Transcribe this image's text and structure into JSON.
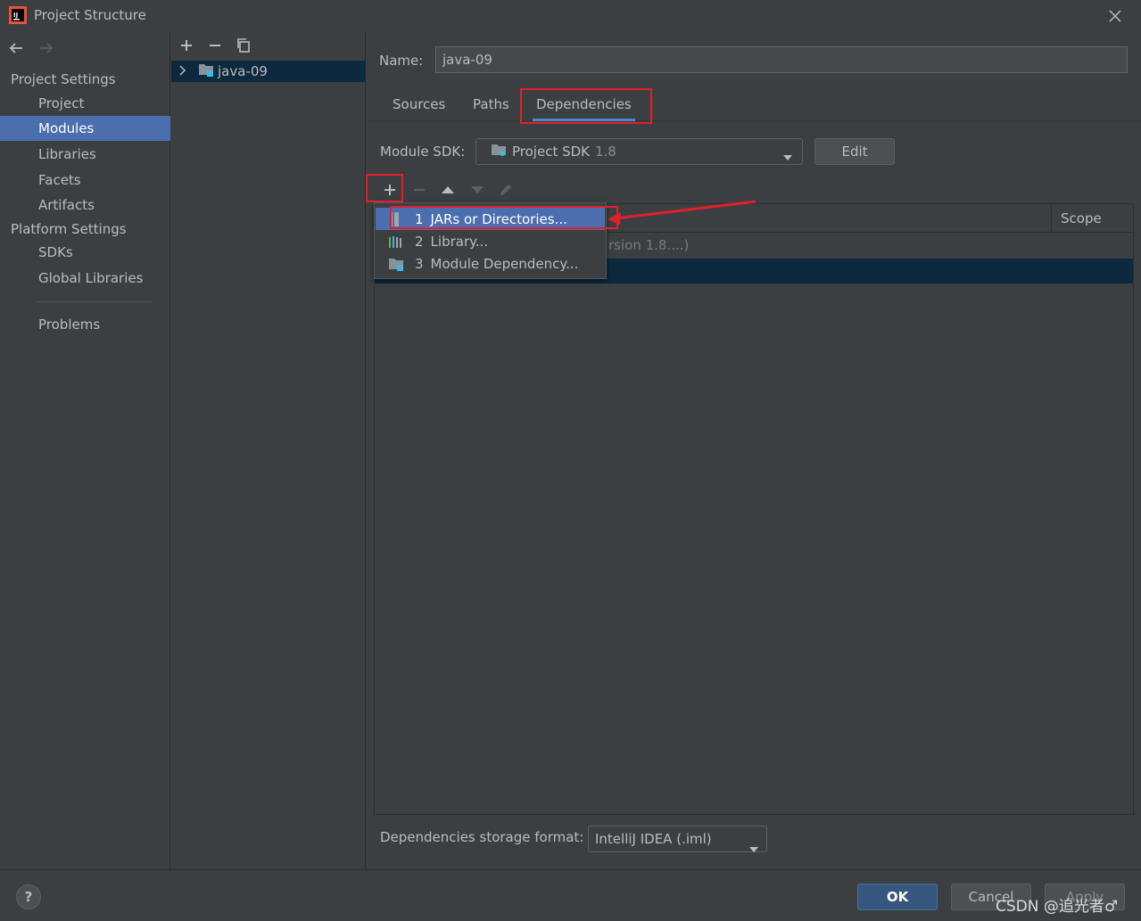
{
  "window": {
    "title": "Project Structure"
  },
  "left_nav": {
    "project_settings_label": "Project Settings",
    "project_items": [
      "Project",
      "Modules",
      "Libraries",
      "Facets",
      "Artifacts"
    ],
    "platform_settings_label": "Platform Settings",
    "platform_items": [
      "SDKs",
      "Global Libraries"
    ],
    "problems_label": "Problems",
    "selected": "Modules"
  },
  "module_tree": {
    "items": [
      "java-09"
    ]
  },
  "module": {
    "name_label": "Name:",
    "name_value": "java-09",
    "tabs": [
      "Sources",
      "Paths",
      "Dependencies"
    ],
    "active_tab": "Dependencies",
    "sdk_label": "Module SDK:",
    "sdk_value": "Project SDK",
    "sdk_version": "1.8",
    "edit_label": "Edit"
  },
  "dependencies": {
    "scope_header": "Scope",
    "row1_text": "rsion 1.8....)"
  },
  "add_menu": {
    "items": [
      {
        "num": "1",
        "label": "JARs or Directories..."
      },
      {
        "num": "2",
        "label": "Library..."
      },
      {
        "num": "3",
        "label": "Module Dependency..."
      }
    ]
  },
  "storage": {
    "label": "Dependencies storage format:",
    "value": "IntelliJ IDEA (.iml)"
  },
  "footer": {
    "help": "?",
    "ok": "OK",
    "cancel": "Cancel",
    "apply": "Apply",
    "watermark": "CSDN @追光者♂"
  },
  "colors": {
    "background": "#3c3f41",
    "selection": "#4b6eaf",
    "annotation_red": "#e0212b",
    "ok_button": "#365880"
  }
}
